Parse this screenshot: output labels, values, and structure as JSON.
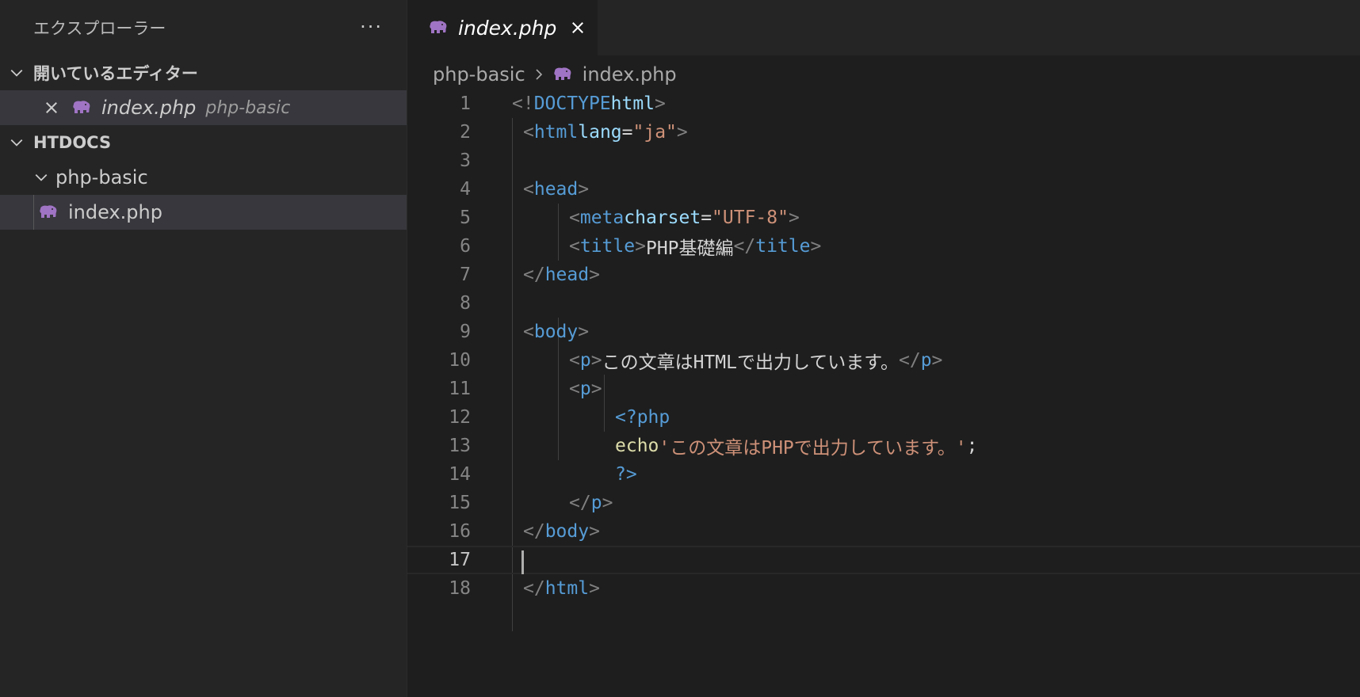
{
  "explorer": {
    "title": "エクスプローラー",
    "more": "···",
    "open_editors": {
      "label": "開いているエディター",
      "items": [
        {
          "name": "index.php",
          "folder": "php-basic"
        }
      ]
    },
    "workspace": {
      "label": "HTDOCS",
      "folder": "php-basic",
      "file": "index.php"
    }
  },
  "tab": {
    "label": "index.php"
  },
  "breadcrumb": {
    "folder": "php-basic",
    "file": "index.php"
  },
  "code": {
    "active_line": 17,
    "lines": [
      {
        "n": "1"
      },
      {
        "n": "2"
      },
      {
        "n": "3"
      },
      {
        "n": "4"
      },
      {
        "n": "5"
      },
      {
        "n": "6"
      },
      {
        "n": "7"
      },
      {
        "n": "8"
      },
      {
        "n": "9"
      },
      {
        "n": "10"
      },
      {
        "n": "11"
      },
      {
        "n": "12"
      },
      {
        "n": "13"
      },
      {
        "n": "14"
      },
      {
        "n": "15"
      },
      {
        "n": "16"
      },
      {
        "n": "17"
      },
      {
        "n": "18"
      }
    ],
    "tokens": {
      "doctype": "DOCTYPE",
      "html": "html",
      "lang_attr": "lang",
      "lang_val": "\"ja\"",
      "head": "head",
      "meta": "meta",
      "charset_attr": "charset",
      "charset_val": "\"UTF-8\"",
      "title_tag": "title",
      "title_text": "PHP基礎編",
      "body": "body",
      "p": "p",
      "p_text": "この文章はHTMLで出力しています。",
      "php_open": "<?php",
      "echo": "echo",
      "echo_str": "'この文章はPHPで出力しています。'",
      "semicolon": ";",
      "php_close": "?>"
    }
  },
  "colors": {
    "accent_elephant": "#a074c4"
  }
}
